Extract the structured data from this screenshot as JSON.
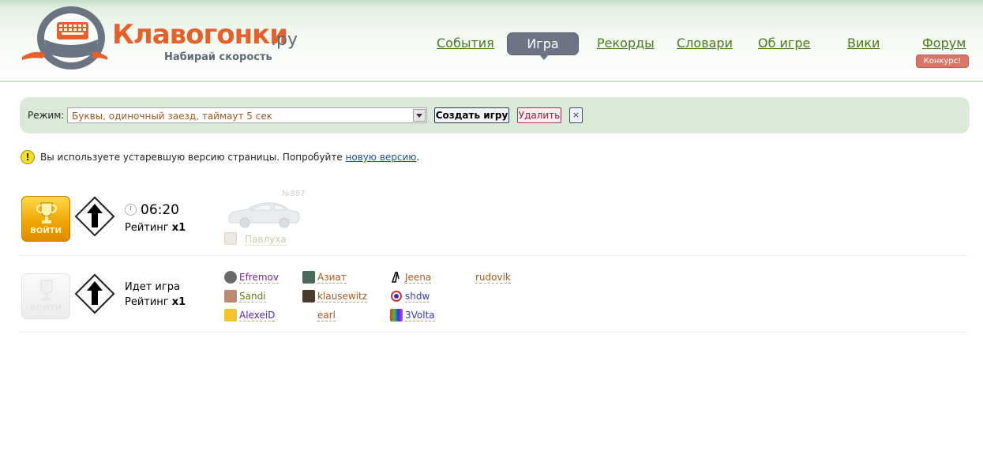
{
  "header": {
    "logo_text": "Клавогонки",
    "logo_domain": ".ру",
    "slogan": "Набирай скорость",
    "nav": [
      "События",
      "Игра",
      "Рекорды",
      "Словари",
      "Об игре",
      "Вики",
      "Форум"
    ],
    "active_nav": "Игра",
    "forum_badge": "Конкурс!"
  },
  "toolbar": {
    "mode_label": "Режим:",
    "mode_value": "Буквы, одиночный заезд, таймаут 5 сек",
    "create_label": "Создать игру",
    "delete_label": "Удалить",
    "close_label": "×"
  },
  "warning": {
    "text": "Вы используете устаревшую версию страницы. Попробуйте",
    "link": "новую версию",
    "suffix": "."
  },
  "games": [
    {
      "enter_label": "ВОЙТИ",
      "timer": "06:20",
      "rating_label": "Рейтинг",
      "rating_mult": "x1",
      "car_number": "№887",
      "ghost_player": "Павлуха"
    },
    {
      "enter_label": "ВОЙТИ",
      "status": "Идет игра",
      "rating_label": "Рейтинг",
      "rating_mult": "x1",
      "players": [
        "Efremov",
        "Sandi",
        "AlexeiD",
        "Азиат",
        "klausewitz",
        "earl",
        "Jeena",
        "shdw",
        "3Volta",
        "rudovik"
      ]
    }
  ],
  "colors": {
    "nav_link": "#4a7a1a",
    "nav_active_bg": "#6d7585",
    "toolbar_bg": "#d9ead7",
    "mode_text": "#a35a1f",
    "enter_gold": "#f0a300"
  }
}
